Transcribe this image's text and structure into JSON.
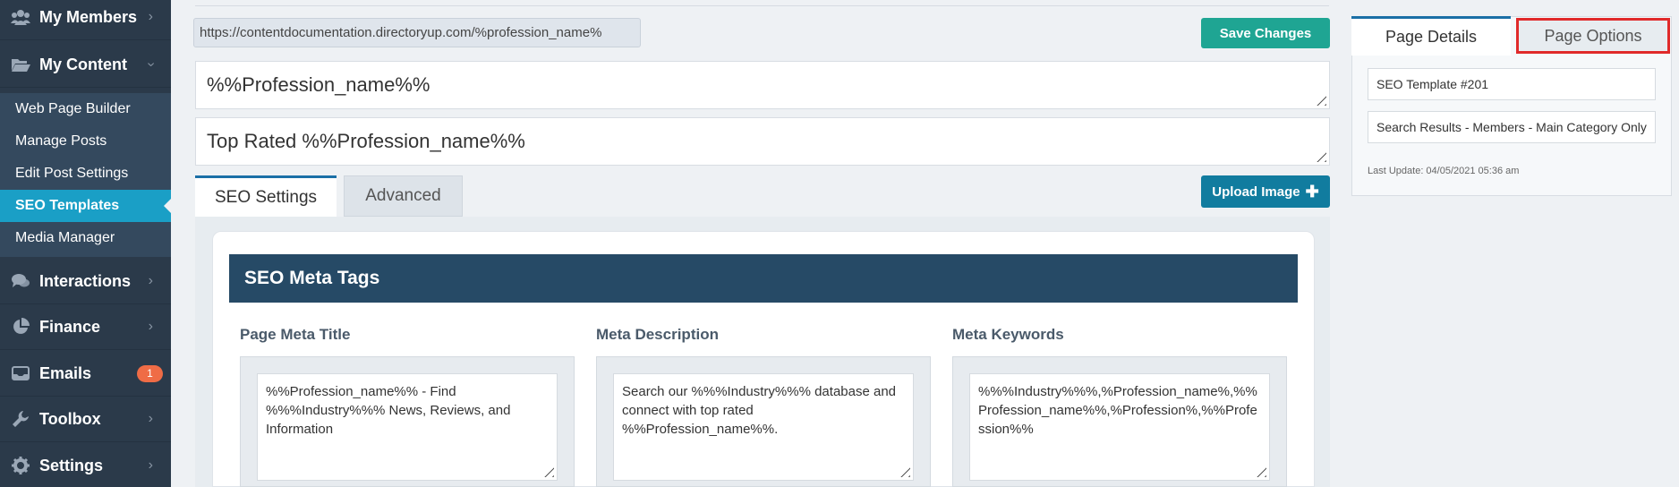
{
  "sidebar": {
    "items": [
      {
        "label": "My Members",
        "icon": "users-icon"
      },
      {
        "label": "My Content",
        "icon": "folder-open-icon"
      },
      {
        "label": "Interactions",
        "icon": "comments-icon"
      },
      {
        "label": "Finance",
        "icon": "pie-chart-icon"
      },
      {
        "label": "Emails",
        "icon": "inbox-icon",
        "badge": "1"
      },
      {
        "label": "Toolbox",
        "icon": "wrench-icon"
      },
      {
        "label": "Settings",
        "icon": "gear-icon"
      }
    ],
    "submenu": [
      {
        "label": "Web Page Builder"
      },
      {
        "label": "Manage Posts"
      },
      {
        "label": "Edit Post Settings"
      },
      {
        "label": "SEO Templates",
        "active": true
      },
      {
        "label": "Media Manager"
      }
    ]
  },
  "main": {
    "url": "https://contentdocumentation.directoryup.com/%profession_name%",
    "save_label": "Save Changes",
    "title_value": "%%Profession_name%%",
    "subtitle_value": "Top Rated %%Profession_name%%",
    "tabs": [
      {
        "label": "SEO Settings"
      },
      {
        "label": "Advanced"
      }
    ],
    "upload_label": "Upload Image",
    "card_title": "SEO Meta Tags",
    "columns": [
      {
        "label": "Page Meta Title",
        "value": "%%Profession_name%% - Find %%%Industry%%% News, Reviews, and Information"
      },
      {
        "label": "Meta Description",
        "value": "Search our %%%Industry%%% database and connect with top rated %%Profession_name%%."
      },
      {
        "label": "Meta Keywords",
        "value": "%%%Industry%%%,%Profession_name%,%%Profession_name%%,%Profession%,%%Profession%%"
      }
    ]
  },
  "right_panel": {
    "tabs": [
      {
        "label": "Page Details"
      },
      {
        "label": "Page Options"
      }
    ],
    "template_name": "SEO Template #201",
    "template_type": "Search Results - Members - Main Category Only",
    "last_update": "Last Update: 04/05/2021 05:36 am"
  },
  "colors": {
    "sidebar_bg": "#2b3a4a",
    "active_item": "#1a9fc6",
    "save_button": "#1fa593",
    "upload_button": "#117c9f",
    "card_header": "#264a66",
    "highlight_box": "#e02a2a",
    "badge": "#ef6c46"
  }
}
